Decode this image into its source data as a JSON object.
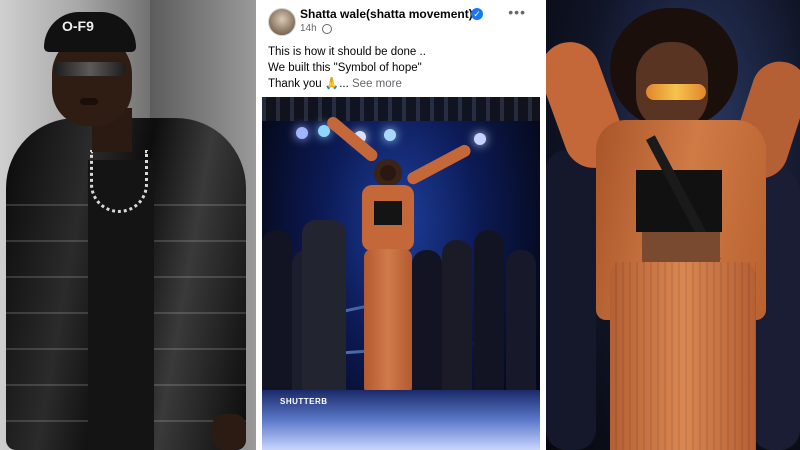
{
  "post": {
    "author": "Shatta wale(shatta movement)",
    "verified_icon": "verified-badge-icon",
    "time": "14h",
    "privacy_icon": "globe-icon",
    "more_icon": "more-options-icon",
    "lines": [
      "This is how it should be done ..",
      "We built this \"Symbol of hope\"",
      "Thank you 🙏..."
    ],
    "see_more": "See more"
  },
  "photos": {
    "stage_watermark": "SHUTTERB"
  },
  "colors": {
    "outfit": "#c4683a",
    "link_blue": "#1877f2",
    "secondary_text": "#65676b"
  }
}
